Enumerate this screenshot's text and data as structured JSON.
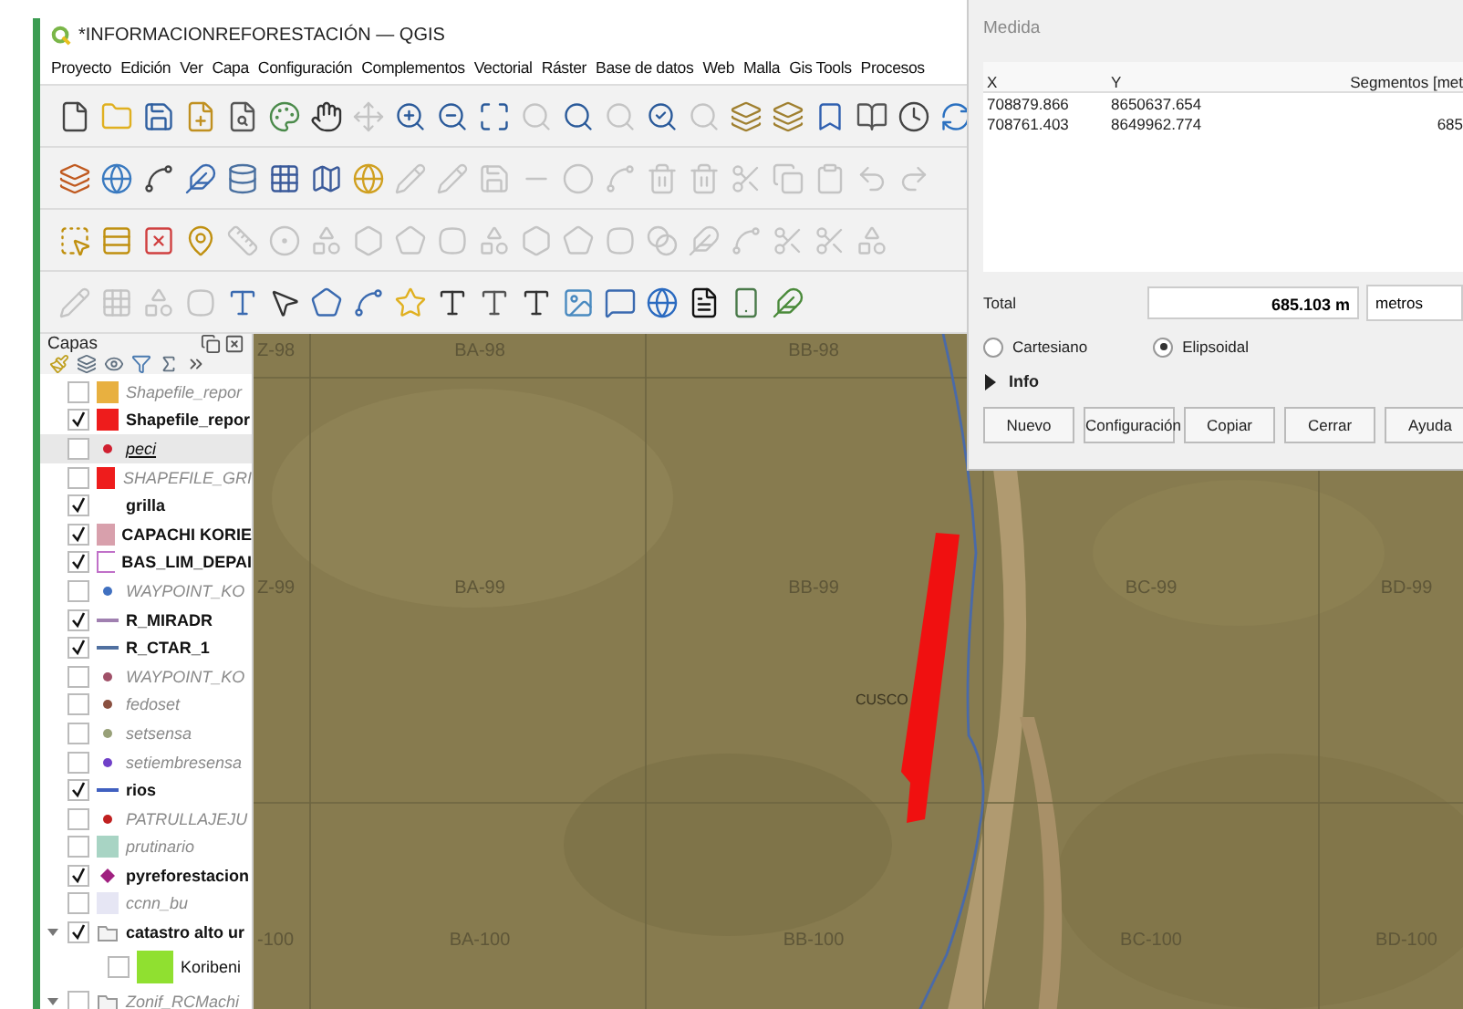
{
  "window": {
    "title": "*INFORMACIONREFORESTACIÓN — QGIS"
  },
  "menu": [
    "Proyecto",
    "Edición",
    "Ver",
    "Capa",
    "Configuración",
    "Complementos",
    "Vectorial",
    "Ráster",
    "Base de datos",
    "Web",
    "Malla",
    "Gis Tools",
    "Procesos"
  ],
  "toolbars": [
    {
      "icons": [
        {
          "disabled": false
        },
        {
          "disabled": false
        },
        {
          "disabled": false
        },
        {
          "disabled": false
        },
        {
          "disabled": false
        },
        {
          "disabled": false
        },
        {
          "disabled": false
        },
        {
          "disabled": true
        },
        {
          "disabled": false
        },
        {
          "disabled": false
        },
        {
          "disabled": false
        },
        {
          "disabled": true
        },
        {
          "disabled": false
        },
        {
          "disabled": true
        },
        {
          "disabled": false
        },
        {
          "disabled": true
        },
        {
          "disabled": false
        },
        {
          "disabled": false
        },
        {
          "disabled": false
        },
        {
          "disabled": false
        },
        {
          "disabled": false
        },
        {
          "disabled": false
        }
      ]
    },
    {
      "icons": [
        {
          "disabled": false
        },
        {
          "disabled": false
        },
        {
          "disabled": false
        },
        {
          "disabled": false
        },
        {
          "disabled": false
        },
        {
          "disabled": false
        },
        {
          "disabled": false
        },
        {
          "disabled": false
        },
        {
          "disabled": true
        },
        {
          "disabled": true
        },
        {
          "disabled": true
        },
        {
          "disabled": true
        },
        {
          "disabled": true
        },
        {
          "disabled": true
        },
        {
          "disabled": true
        },
        {
          "disabled": true
        },
        {
          "disabled": true
        },
        {
          "disabled": true
        },
        {
          "disabled": true
        },
        {
          "disabled": true
        },
        {
          "disabled": true
        }
      ]
    },
    {
      "icons": [
        {
          "disabled": false
        },
        {
          "disabled": false
        },
        {
          "disabled": false
        },
        {
          "disabled": false
        },
        {
          "disabled": true
        },
        {
          "disabled": true
        },
        {
          "disabled": true
        },
        {
          "disabled": true
        },
        {
          "disabled": true
        },
        {
          "disabled": true
        },
        {
          "disabled": true
        },
        {
          "disabled": true
        },
        {
          "disabled": true
        },
        {
          "disabled": true
        },
        {
          "disabled": true
        },
        {
          "disabled": true
        },
        {
          "disabled": true
        },
        {
          "disabled": true
        },
        {
          "disabled": true
        },
        {
          "disabled": true
        }
      ]
    },
    {
      "icons": [
        {
          "disabled": true
        },
        {
          "disabled": true
        },
        {
          "disabled": true
        },
        {
          "disabled": true
        },
        {
          "disabled": false
        },
        {
          "disabled": false
        },
        {
          "disabled": false
        },
        {
          "disabled": false
        },
        {
          "disabled": false
        },
        {
          "disabled": false
        },
        {
          "disabled": false
        },
        {
          "disabled": false
        },
        {
          "disabled": false
        },
        {
          "disabled": false
        },
        {
          "disabled": false
        },
        {
          "disabled": false
        },
        {
          "disabled": false
        },
        {
          "disabled": false
        }
      ]
    }
  ],
  "layers_panel": {
    "title": "Capas",
    "layers": [
      {
        "name": "Shapefile_repor",
        "checked": false,
        "selected": false,
        "kind": "fill",
        "color": "#e8b040"
      },
      {
        "name": "Shapefile_repor",
        "checked": true,
        "selected": false,
        "kind": "fill",
        "color": "#ee1c1c"
      },
      {
        "name": "peci",
        "checked": false,
        "selected": true,
        "kind": "point",
        "color": "#d02030"
      },
      {
        "name": "SHAPEFILE_GRI",
        "checked": false,
        "selected": false,
        "kind": "fill",
        "color": "#ee1c1c"
      },
      {
        "name": "grilla",
        "checked": true,
        "selected": false,
        "kind": "none"
      },
      {
        "name": "CAPACHI KORIE",
        "checked": true,
        "selected": false,
        "kind": "fill",
        "color": "#d8a0ac"
      },
      {
        "name": "BAS_LIM_DEPAI",
        "checked": true,
        "selected": false,
        "kind": "outline",
        "color": "#c070c8"
      },
      {
        "name": "WAYPOINT_KO",
        "checked": false,
        "selected": false,
        "kind": "point",
        "color": "#4070c0"
      },
      {
        "name": "R_MIRADR",
        "checked": true,
        "selected": false,
        "kind": "line",
        "color": "#a080b0"
      },
      {
        "name": "R_CTAR_1",
        "checked": true,
        "selected": false,
        "kind": "line",
        "color": "#5070a0"
      },
      {
        "name": "WAYPOINT_KO",
        "checked": false,
        "selected": false,
        "kind": "point",
        "color": "#a05068"
      },
      {
        "name": "fedoset",
        "checked": false,
        "selected": false,
        "kind": "point",
        "color": "#8a5040"
      },
      {
        "name": "setsensa",
        "checked": false,
        "selected": false,
        "kind": "point",
        "color": "#98a078"
      },
      {
        "name": "setiembresensa",
        "checked": false,
        "selected": false,
        "kind": "point",
        "color": "#7040c8"
      },
      {
        "name": "rios",
        "checked": true,
        "selected": false,
        "kind": "line",
        "color": "#4060c0"
      },
      {
        "name": "PATRULLAJEJU",
        "checked": false,
        "selected": false,
        "kind": "point",
        "color": "#c02020"
      },
      {
        "name": "prutinario",
        "checked": false,
        "selected": false,
        "kind": "fill",
        "color": "#a8d4c4"
      },
      {
        "name": "pyreforestacion",
        "checked": true,
        "selected": false,
        "kind": "diamond",
        "color": "#a02080"
      },
      {
        "name": "ccnn_bu",
        "checked": false,
        "selected": false,
        "kind": "fill",
        "color": "#e6e6f4"
      },
      {
        "name": "catastro alto ur",
        "checked": true,
        "selected": false,
        "kind": "group",
        "expanded": true,
        "children": [
          {
            "name": "Koribeni",
            "checked": false,
            "selected": false,
            "kind": "class",
            "color": "#90e030"
          }
        ]
      },
      {
        "name": "Zonif_RCMachi",
        "checked": false,
        "selected": false,
        "kind": "group",
        "expanded": true
      }
    ]
  },
  "map": {
    "grid_labels": [
      [
        "Z-98",
        "BA-98",
        "BB-98"
      ],
      [
        "Z-99",
        "BA-99",
        "BB-99",
        "BC-99",
        "BD-99"
      ],
      [
        "-100",
        "BA-100",
        "BB-100",
        "BC-100",
        "BD-100"
      ]
    ],
    "place_label": "CUSCO"
  },
  "dialog": {
    "title": "Medida",
    "columns": [
      "X",
      "Y",
      "Segmentos [met"
    ],
    "rows": [
      [
        "708879.866",
        "8650637.654",
        ""
      ],
      [
        "708761.403",
        "8649962.774",
        "685"
      ]
    ],
    "total_label": "Total",
    "total_value": "685.103 m",
    "unit": "metros",
    "modes": [
      {
        "label": "Cartesiano",
        "selected": false
      },
      {
        "label": "Elipsoidal",
        "selected": true
      }
    ],
    "info": {
      "label": "Info",
      "expanded": false
    },
    "buttons": [
      "Nuevo",
      "Configuración",
      "Copiar",
      "Cerrar",
      "Ayuda"
    ]
  }
}
